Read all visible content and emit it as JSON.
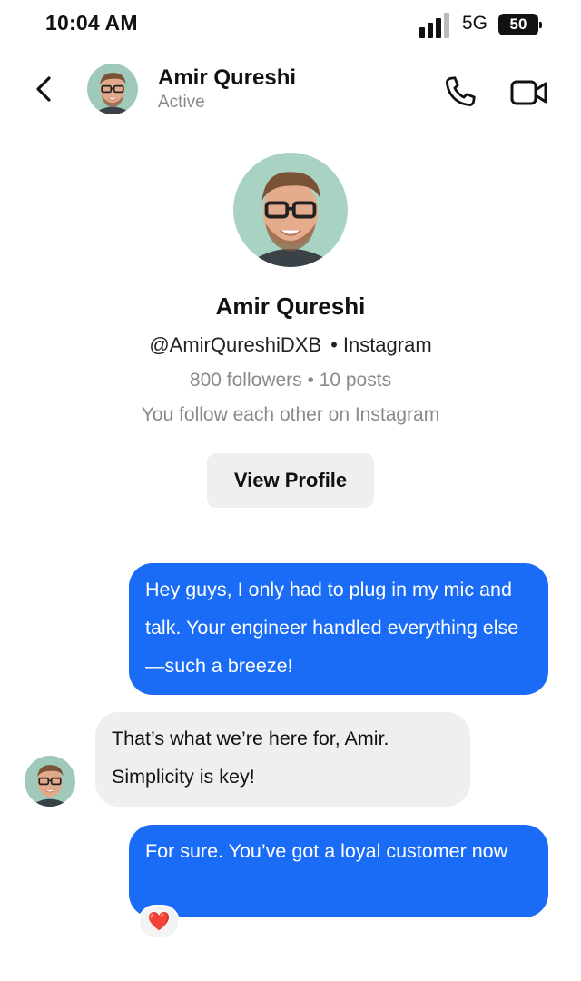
{
  "status_bar": {
    "time": "10:04 AM",
    "network": "5G",
    "battery": "50"
  },
  "header": {
    "contact_name": "Amir Qureshi",
    "presence": "Active",
    "icons": [
      "back-icon",
      "phone-icon",
      "video-camera-icon"
    ]
  },
  "profile": {
    "name": "Amir Qureshi",
    "handle": "@AmirQureshiDXB",
    "separator": "•",
    "platform": "Instagram",
    "stats": "800 followers • 10 posts",
    "mutual_text": "You follow each other on Instagram",
    "view_profile_label": "View Profile"
  },
  "messages": [
    {
      "direction": "outgoing",
      "text": "Hey guys, I only had to plug in my mic and talk. Your engineer handled everything else—such a breeze!"
    },
    {
      "direction": "incoming",
      "text": "That’s what we’re here for, Amir. Simplicity is key!"
    },
    {
      "direction": "outgoing",
      "text": "For sure. You’ve got a loyal customer now",
      "reaction": "❤️"
    }
  ],
  "colors": {
    "outgoing_bubble": "#1a6cf6",
    "incoming_bubble": "#efefef",
    "muted_text": "#8a8a8a"
  }
}
